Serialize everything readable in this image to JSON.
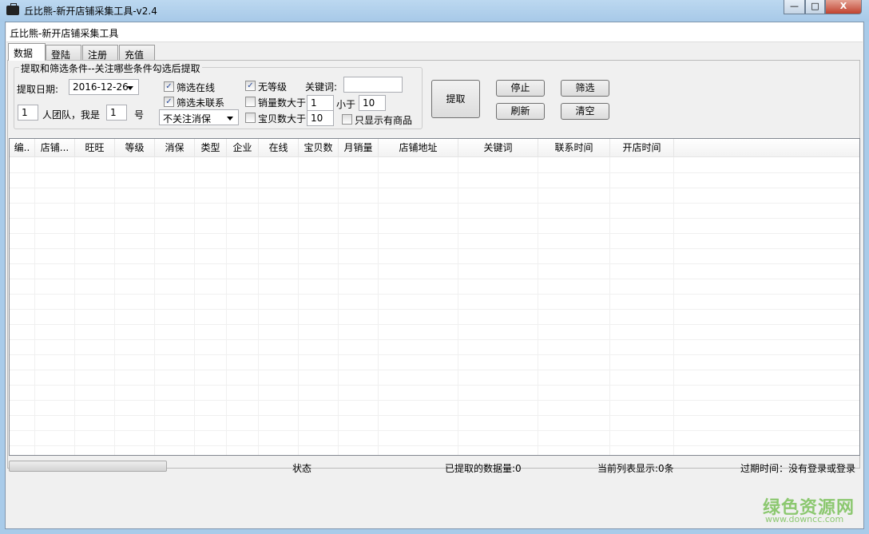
{
  "window": {
    "title": "丘比熊-新开店铺采集工具-v2.4",
    "controls": {
      "minimize": "—",
      "maximize": "□",
      "close": "X"
    }
  },
  "header": {
    "text": "丘比熊-新开店铺采集工具"
  },
  "tabs": [
    {
      "label": "数据",
      "active": true
    },
    {
      "label": "登陆"
    },
    {
      "label": "注册"
    },
    {
      "label": "充值"
    }
  ],
  "filters": {
    "group_title": "提取和筛选条件--关注哪些条件勾选后提取",
    "date_label": "提取日期:",
    "date_value": "2016-12-26",
    "team_size": "1",
    "team_label": "人团队，我是",
    "member_no": "1",
    "member_suffix": "号",
    "filter_online": {
      "label": "筛选在线",
      "checked": true
    },
    "filter_uncontacted": {
      "label": "筛选未联系",
      "checked": true
    },
    "guarantee_select": "不关注消保",
    "no_level": {
      "label": "无等级",
      "checked": true
    },
    "sales_gt": {
      "label": "销量数大于",
      "checked": false,
      "value": "1"
    },
    "less_than_label": "小于",
    "sales_lt_value": "10",
    "items_gt": {
      "label": "宝贝数大于",
      "checked": false,
      "value": "10"
    },
    "only_with_goods": {
      "label": "只显示有商品",
      "checked": false
    },
    "keyword_label": "关键词:",
    "keyword_value": ""
  },
  "buttons": {
    "extract": "提取",
    "stop": "停止",
    "filter": "筛选",
    "refresh": "刷新",
    "clear": "清空"
  },
  "table": {
    "columns": [
      "编..",
      "店铺...",
      "旺旺",
      "等级",
      "消保",
      "类型",
      "企业",
      "在线",
      "宝贝数",
      "月销量",
      "店铺地址",
      "关键词",
      "联系时间",
      "开店时间"
    ],
    "rows": []
  },
  "status": {
    "progress": 0,
    "state": "状态",
    "extracted": "已提取的数据量:0",
    "current": "当前列表显示:0条",
    "expiry": "过期时间：没有登录或登录"
  },
  "watermark": {
    "name": "绿色资源网",
    "url": "www.downcc.com"
  }
}
